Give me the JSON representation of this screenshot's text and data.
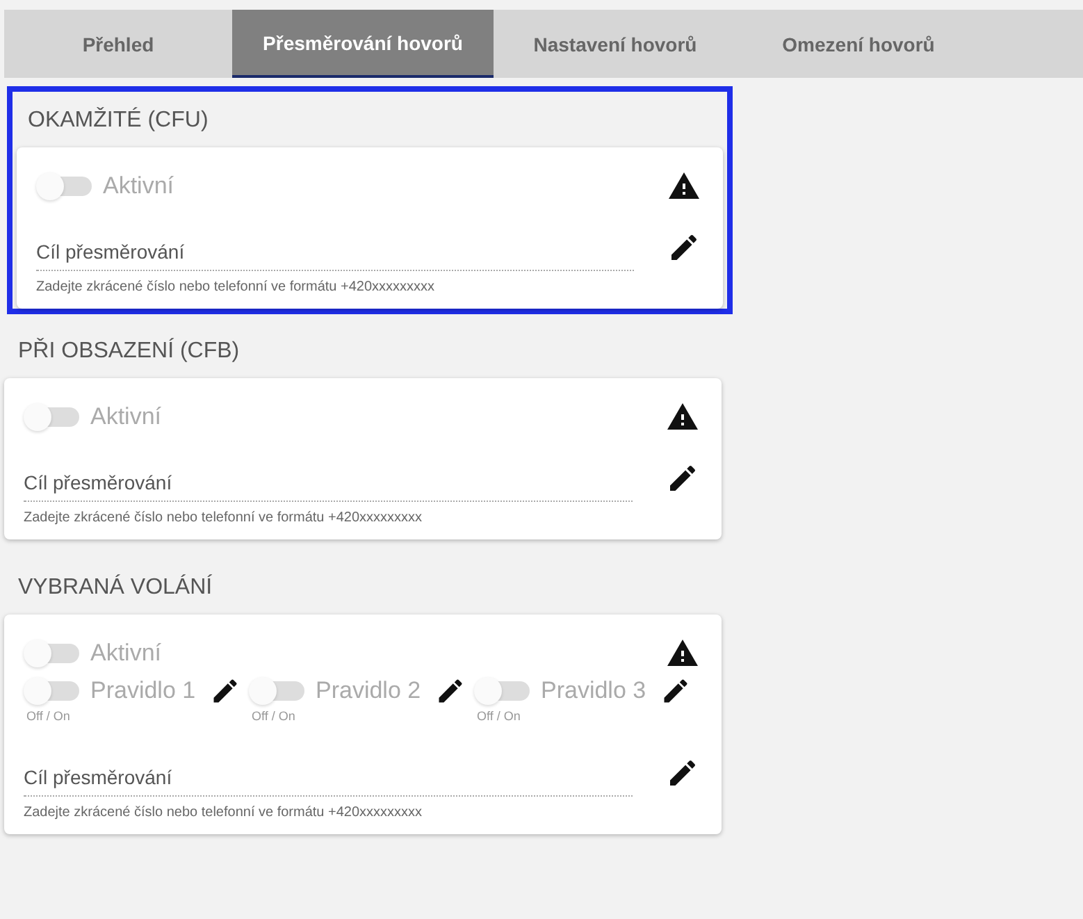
{
  "tabs": [
    {
      "label": "Přehled",
      "selected": false
    },
    {
      "label": "Přesměrování hovorů",
      "selected": true
    },
    {
      "label": "Nastavení hovorů",
      "selected": false
    },
    {
      "label": "Omezení hovorů",
      "selected": false
    }
  ],
  "sections": [
    {
      "title": "OKAMŽITÉ (CFU)",
      "highlighted": true,
      "active": {
        "label": "Aktivní",
        "on": false,
        "disabled": true
      },
      "field": {
        "label": "Cíl přesměrování",
        "hint": "Zadejte zkrácené číslo nebo telefonní ve formátu +420xxxxxxxxx"
      }
    },
    {
      "title": "PŘI OBSAZENÍ (CFB)",
      "highlighted": false,
      "active": {
        "label": "Aktivní",
        "on": false,
        "disabled": true
      },
      "field": {
        "label": "Cíl přesměrování",
        "hint": "Zadejte zkrácené číslo nebo telefonní ve formátu +420xxxxxxxxx"
      }
    },
    {
      "title": "VYBRANÁ VOLÁNÍ",
      "highlighted": false,
      "active": {
        "label": "Aktivní",
        "on": false,
        "disabled": true
      },
      "rules": [
        {
          "label": "Pravidlo 1",
          "on": false,
          "disabled": true,
          "caption": "Off / On"
        },
        {
          "label": "Pravidlo 2",
          "on": false,
          "disabled": true,
          "caption": "Off / On"
        },
        {
          "label": "Pravidlo 3",
          "on": false,
          "disabled": true,
          "caption": "Off / On"
        }
      ],
      "field": {
        "label": "Cíl přesměrování",
        "hint": "Zadejte zkrácené číslo nebo telefonní ve formátu +420xxxxxxxxx"
      }
    }
  ]
}
